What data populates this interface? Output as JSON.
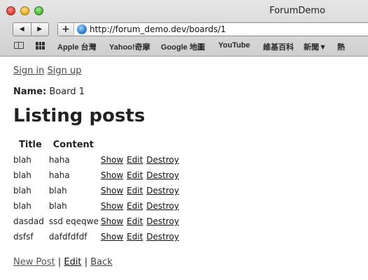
{
  "window": {
    "title": "ForumDemo"
  },
  "address": {
    "url": "http://forum_demo.dev/boards/1"
  },
  "bookmarks": [
    "Apple 台灣",
    "Yahoo!奇摩",
    "Google 地圖",
    "YouTube",
    "維基百科",
    "新聞▼",
    "熱"
  ],
  "nav": {
    "sign_in": "Sign in",
    "sign_up": "Sign up"
  },
  "board": {
    "name_label": "Name:",
    "name_value": "Board 1"
  },
  "page": {
    "heading": "Listing posts"
  },
  "table": {
    "headers": [
      "Title",
      "Content"
    ],
    "rows": [
      {
        "title": "blah",
        "content": "haha"
      },
      {
        "title": "blah",
        "content": "haha"
      },
      {
        "title": "blah",
        "content": "blah"
      },
      {
        "title": "blah",
        "content": "blah"
      },
      {
        "title": "dasdad",
        "content": "ssd eqeqwe"
      },
      {
        "title": "dsfsf",
        "content": "dafdfdfdf"
      }
    ],
    "actions": {
      "show": "Show",
      "edit": "Edit",
      "destroy": "Destroy"
    }
  },
  "footer": {
    "new_post": "New Post",
    "sep": "|",
    "edit": "Edit",
    "back": "Back"
  }
}
